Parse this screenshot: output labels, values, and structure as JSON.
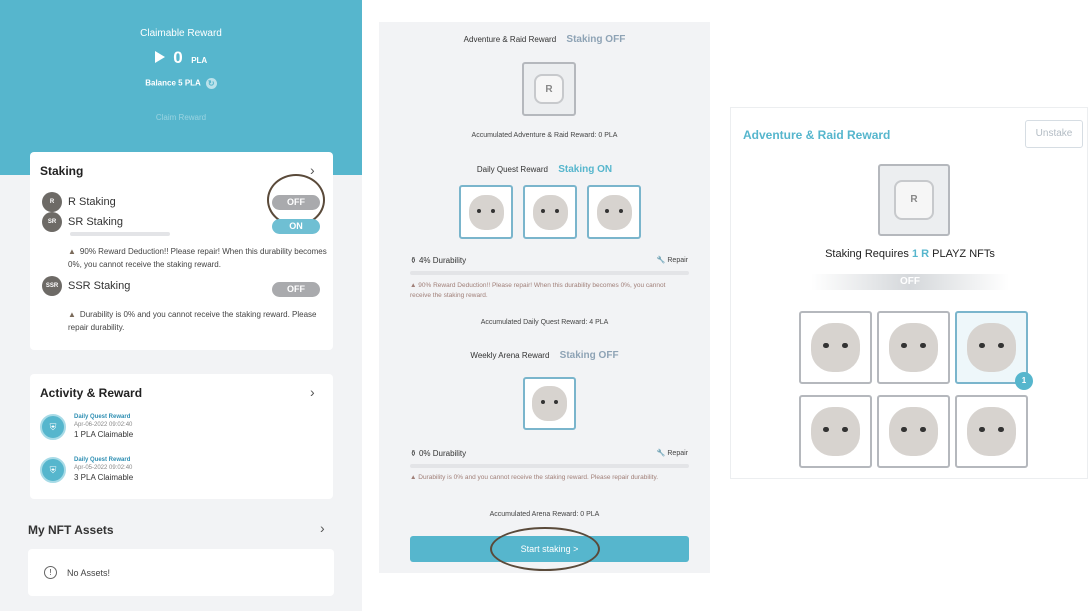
{
  "left": {
    "claimable_title": "Claimable Reward",
    "claimable_amount": "0",
    "claimable_unit": "PLA",
    "balance": "Balance 5 PLA",
    "claim_label": "Claim Reward",
    "staking": {
      "title": "Staking",
      "items": [
        {
          "badge": "R",
          "label": "R Staking",
          "toggle": "OFF"
        },
        {
          "badge": "SR",
          "label": "SR Staking",
          "toggle": "ON"
        },
        {
          "badge": "SSR",
          "label": "SSR Staking",
          "toggle": "OFF"
        }
      ],
      "sr_warning": "90% Reward Deduction!! Please repair! When this durability becomes 0%, you cannot receive the staking reward.",
      "ssr_warning": "Durability is 0% and you cannot receive the staking reward. Please repair durability."
    },
    "activity": {
      "title": "Activity & Reward",
      "items": [
        {
          "type": "Daily Quest Reward",
          "date": "Apr-06-2022 09:02:40",
          "amount": "1 PLA Claimable"
        },
        {
          "type": "Daily Quest Reward",
          "date": "Apr-05-2022 09:02:40",
          "amount": "3 PLA Claimable"
        }
      ]
    },
    "nft_assets": {
      "title": "My NFT Assets",
      "empty": "No Assets!"
    }
  },
  "middle": {
    "adventure": {
      "title": "Adventure & Raid Reward",
      "status": "Staking OFF",
      "accumulated": "Accumulated Adventure & Raid Reward: 0 PLA"
    },
    "daily": {
      "title": "Daily Quest Reward",
      "status": "Staking ON",
      "durability": "4% Durability",
      "durability_value": 0.04,
      "repair": "Repair",
      "warning": "90% Reward Deduction!! Please repair! When this durability becomes 0%, you cannot receive the staking reward.",
      "accumulated": "Accumulated Daily Quest Reward: 4 PLA"
    },
    "weekly": {
      "title": "Weekly Arena Reward",
      "status": "Staking OFF",
      "durability": "0% Durability",
      "durability_value": 0,
      "repair": "Repair",
      "warning": "Durability is 0% and you cannot receive the staking reward. Please repair durability.",
      "accumulated": "Accumulated Arena Reward: 0 PLA"
    },
    "start_button": "Start staking >"
  },
  "right": {
    "title": "Adventure & Raid Reward",
    "unstake": "Unstake",
    "requires_prefix": "Staking Requires",
    "requires_count": "1 R",
    "requires_suffix": "PLAYZ NFTs",
    "status": "OFF",
    "selected_count": "1"
  },
  "colors": {
    "accent": "#56b6cd",
    "toggle_off": "#a9aaad",
    "toggle_on": "#6fbfd3"
  }
}
